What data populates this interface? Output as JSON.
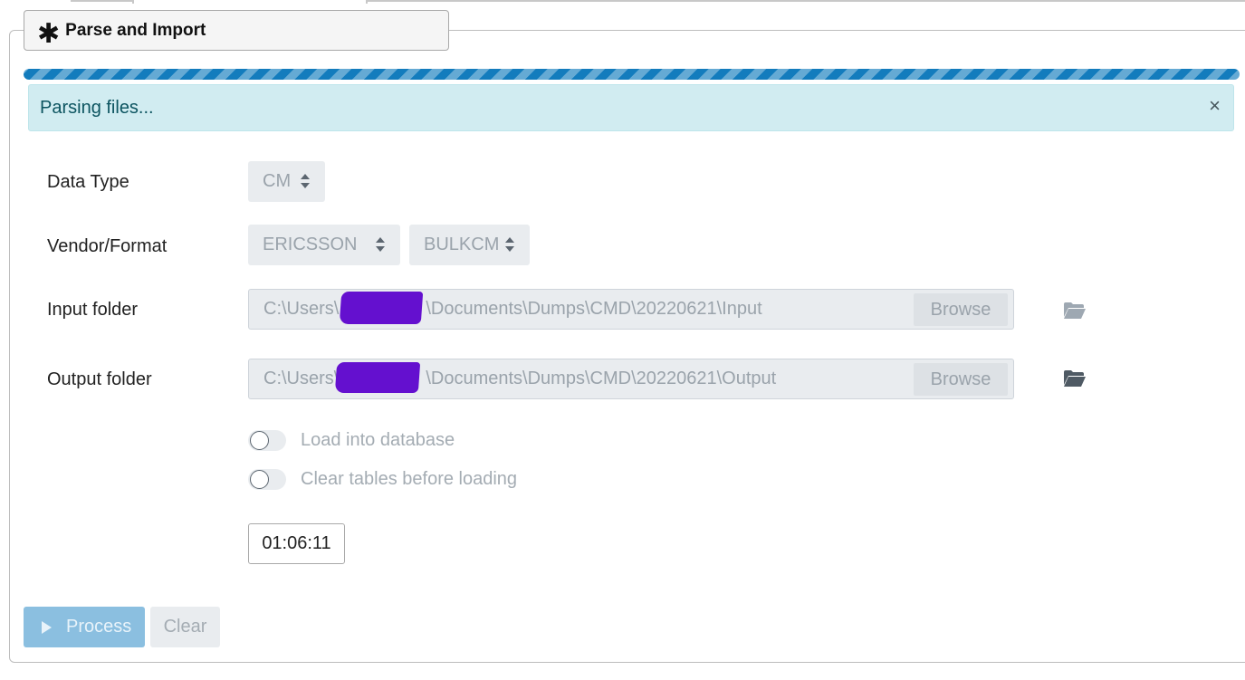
{
  "panel": {
    "title": "Parse and Import",
    "icon": "asterisk-icon"
  },
  "progress": {
    "value": 1.0,
    "color": "#137cbd",
    "striped": true,
    "animated": true
  },
  "callout": {
    "message": "Parsing files...",
    "close_symbol": "×",
    "background": "#d1ecf1"
  },
  "form": {
    "data_type": {
      "label": "Data Type",
      "value": "CM"
    },
    "vendor_format": {
      "label": "Vendor/Format",
      "vendor": "ERICSSON",
      "format": "BULKCM"
    },
    "input_folder": {
      "label": "Input folder",
      "path_prefix": "C:\\Users\\",
      "path_suffix": "\\Documents\\Dumps\\CMD\\20220621\\Input",
      "browse_label": "Browse",
      "icon": "folder-open-icon"
    },
    "output_folder": {
      "label": "Output folder",
      "path_prefix": "C:\\Users\\",
      "path_suffix": "\\Documents\\Dumps\\CMD\\20220621\\Output",
      "browse_label": "Browse",
      "icon": "folder-open-icon"
    },
    "load_into_database": {
      "label": "Load into database",
      "checked": false
    },
    "clear_tables": {
      "label": "Clear tables before loading",
      "checked": false
    },
    "elapsed_time": "01:06:11"
  },
  "actions": {
    "process_label": "Process",
    "clear_label": "Clear"
  },
  "colors": {
    "redaction": "#6410cf",
    "primary_disabled": "#8bbfe0"
  }
}
